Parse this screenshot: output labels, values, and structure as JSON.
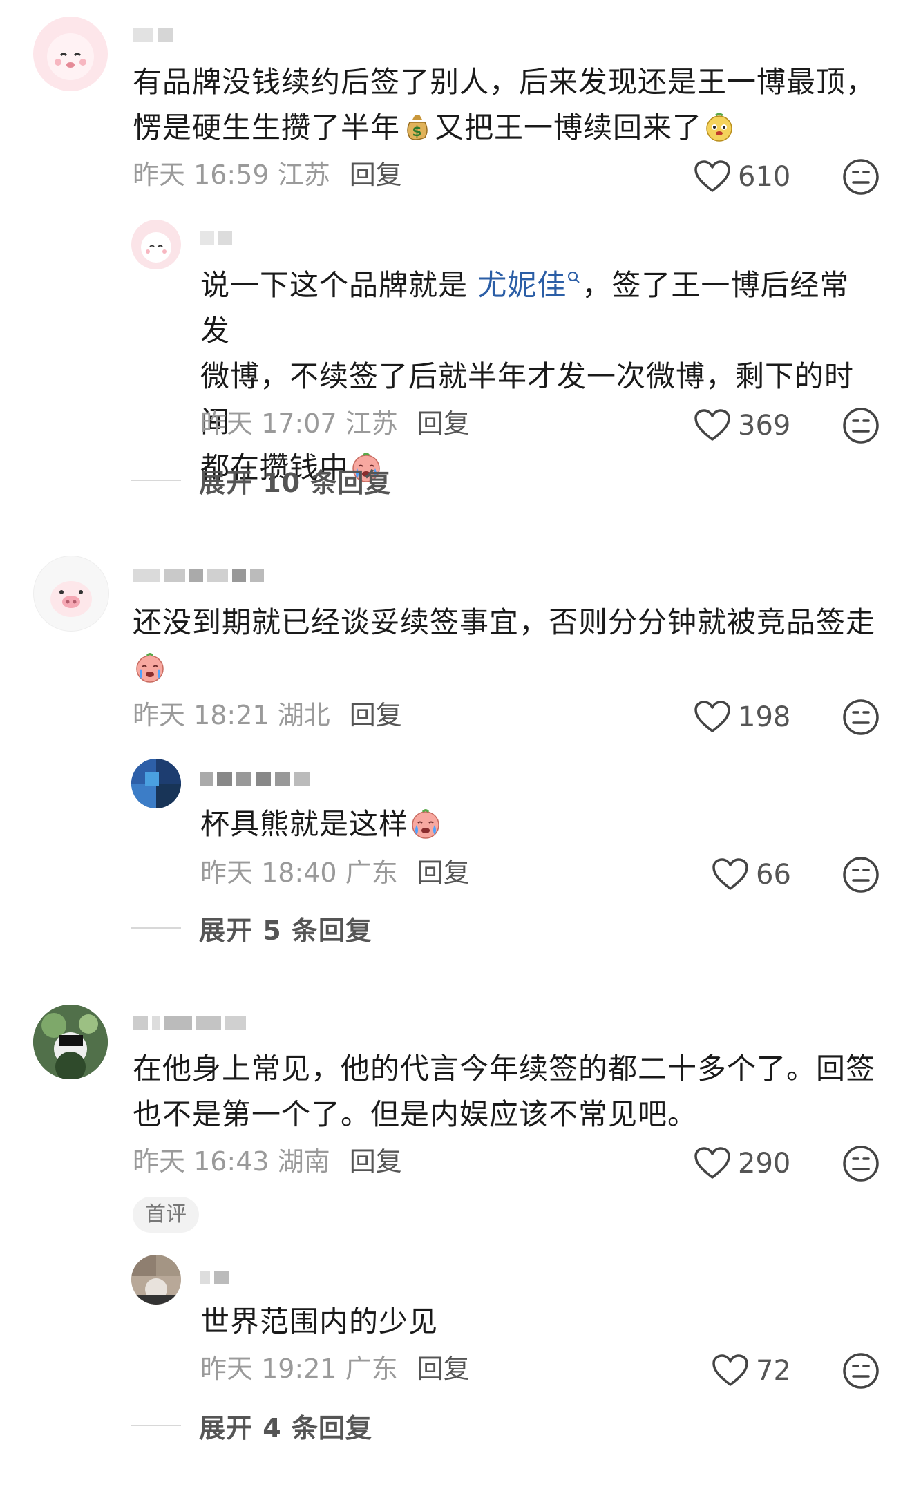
{
  "comments": [
    {
      "text": "有品牌没钱续约后签了别人，后来发现还是王一博最顶，",
      "text2a": "愣是硬生生攒了半年",
      "text2b": "又把王一博续回来了",
      "time": "昨天 16:59",
      "location": "江苏",
      "reply_label": "回复",
      "likes": "610",
      "replies": [
        {
          "text_a": "说一下这个品牌就是 ",
          "link": "尤妮佳",
          "text_b": "，签了王一博后经常发",
          "text_line2": "微博，不续签了后就半年才发一次微博，剩下的时间",
          "text_line3": "都在攒钱中",
          "time": "昨天 17:07",
          "location": "江苏",
          "reply_label": "回复",
          "likes": "369"
        }
      ],
      "expand_label": "展开 10 条回复"
    },
    {
      "text": "还没到期就已经谈妥续签事宜，否则分分钟就被竞品签走",
      "time": "昨天 18:21",
      "location": "湖北",
      "reply_label": "回复",
      "likes": "198",
      "replies": [
        {
          "text": "杯具熊就是这样",
          "time": "昨天 18:40",
          "location": "广东",
          "reply_label": "回复",
          "likes": "66"
        }
      ],
      "expand_label": "展开 5 条回复"
    },
    {
      "text": "在他身上常见，他的代言今年续签的都二十多个了。回签",
      "text2": "也不是第一个了。但是内娱应该不常见吧。",
      "time": "昨天 16:43",
      "location": "湖南",
      "reply_label": "回复",
      "likes": "290",
      "badge": "首评",
      "replies": [
        {
          "text": "世界范围内的少见",
          "time": "昨天 19:21",
          "location": "广东",
          "reply_label": "回复",
          "likes": "72"
        }
      ],
      "expand_label": "展开 4 条回复"
    }
  ],
  "icons": {
    "like": "heart-outline-icon",
    "dislike": "neutral-face-icon",
    "link": "search-icon",
    "money": "money-bag-emoji",
    "crying": "crying-face-emoji",
    "dog": "dog-face-emoji"
  },
  "colors": {
    "link": "#2b5ea6",
    "meta": "#9a9a9a",
    "text": "#1a1a1a"
  }
}
